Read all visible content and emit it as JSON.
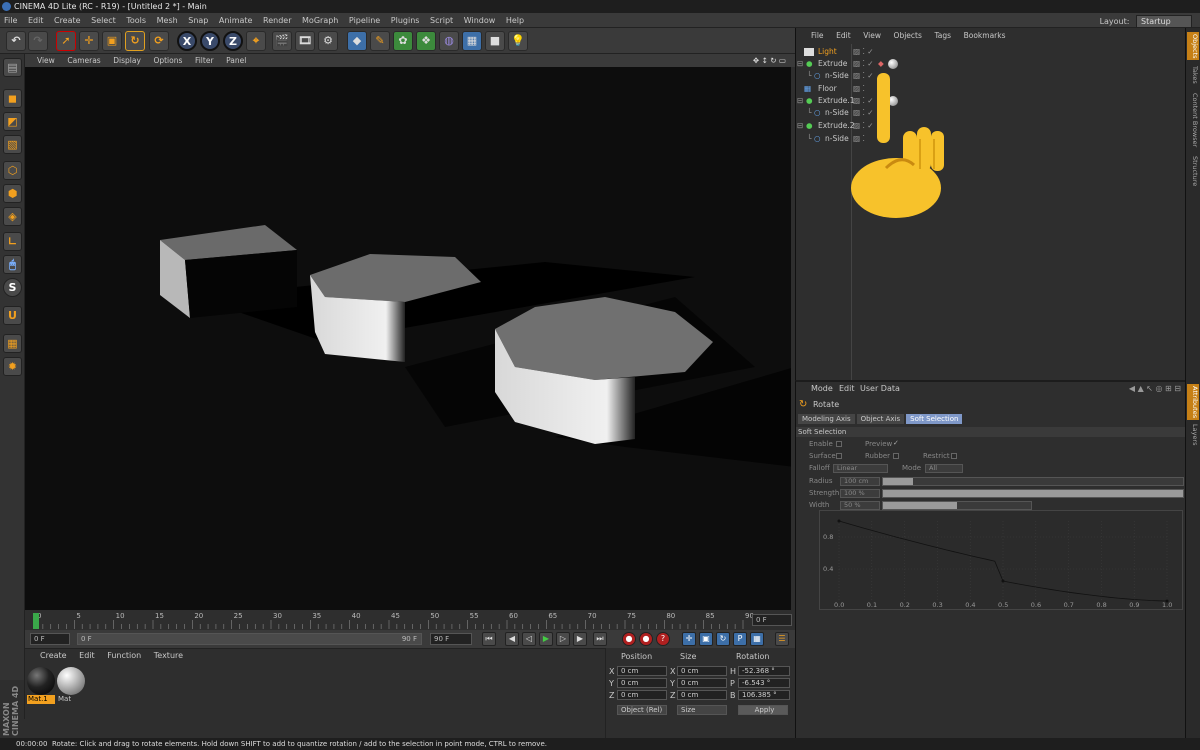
{
  "title_bar": {
    "text": "CINEMA 4D Lite (RC - R19) - [Untitled 2 *] - Main"
  },
  "menu": [
    "File",
    "Edit",
    "Create",
    "Select",
    "Tools",
    "Mesh",
    "Snap",
    "Animate",
    "Render",
    "MoGraph",
    "Pipeline",
    "Plugins",
    "Script",
    "Window",
    "Help"
  ],
  "layout": {
    "label": "Layout:",
    "value": "Startup"
  },
  "viewport": {
    "menu": [
      "View",
      "Cameras",
      "Display",
      "Options",
      "Filter",
      "Panel"
    ]
  },
  "timeline": {
    "ticks": [
      "0",
      "5",
      "10",
      "15",
      "20",
      "25",
      "30",
      "35",
      "40",
      "45",
      "50",
      "55",
      "60",
      "65",
      "70",
      "75",
      "80",
      "85",
      "90"
    ],
    "end_frame": "0 F",
    "current": 0
  },
  "playback": {
    "start_field": "0 F",
    "range_left": "0 F",
    "range_right": "90 F",
    "end_field": "90 F"
  },
  "material_panel": {
    "menu": [
      "Create",
      "Edit",
      "Function",
      "Texture"
    ],
    "materials": [
      {
        "name": "Mat.1",
        "selected": true
      },
      {
        "name": "Mat",
        "selected": false
      }
    ]
  },
  "coordinates": {
    "headers": [
      "Position",
      "Size",
      "Rotation"
    ],
    "rows": [
      {
        "axis": "X",
        "pos": "0 cm",
        "size_axis": "X",
        "size": "0 cm",
        "rot_axis": "H",
        "rot": "-52.368 °"
      },
      {
        "axis": "Y",
        "pos": "0 cm",
        "size_axis": "Y",
        "size": "0 cm",
        "rot_axis": "P",
        "rot": "-6.543 °"
      },
      {
        "axis": "Z",
        "pos": "0 cm",
        "size_axis": "Z",
        "size": "0 cm",
        "rot_axis": "B",
        "rot": "106.385 °"
      }
    ],
    "mode_dropdown": "Object (Rel)",
    "size_dropdown": "Size",
    "apply_label": "Apply"
  },
  "object_manager": {
    "menu": [
      "File",
      "Edit",
      "View",
      "Objects",
      "Tags",
      "Bookmarks"
    ],
    "objects": [
      {
        "name": "Light",
        "level": 0,
        "highlight": true
      },
      {
        "name": "Extrude",
        "level": 0,
        "highlight": false
      },
      {
        "name": "n-Side",
        "level": 1,
        "highlight": false
      },
      {
        "name": "Floor",
        "level": 0,
        "highlight": false
      },
      {
        "name": "Extrude.1",
        "level": 0,
        "highlight": false
      },
      {
        "name": "n-Side",
        "level": 1,
        "highlight": false
      },
      {
        "name": "Extrude.2",
        "level": 0,
        "highlight": false
      },
      {
        "name": "n-Side",
        "level": 1,
        "highlight": false
      }
    ]
  },
  "attributes": {
    "menu": [
      "Mode",
      "Edit",
      "User Data"
    ],
    "tool_name": "Rotate",
    "tabs": [
      "Modeling Axis",
      "Object Axis",
      "Soft Selection"
    ],
    "active_tab": "Soft Selection",
    "section": "Soft Selection",
    "enable_label": "Enable",
    "preview_label": "Preview",
    "preview_check": "✓",
    "surface_label": "Surface",
    "rubber_label": "Rubber",
    "restrict_label": "Restrict",
    "falloff_label": "Falloff",
    "falloff_value": "Linear",
    "mode_label": "Mode",
    "mode_value": "All",
    "radius_label": "Radius",
    "radius_value": "100 cm",
    "radius_fill": 0.1,
    "strength_label": "Strength",
    "strength_value": "100 %",
    "strength_fill": 1.0,
    "width_label": "Width",
    "width_value": "50 %",
    "width_fill": 0.5,
    "graph_y_ticks": [
      "0.8",
      "0.4"
    ],
    "graph_x_ticks": [
      "0.0",
      "0.1",
      "0.2",
      "0.3",
      "0.4",
      "0.5",
      "0.6",
      "0.7",
      "0.8",
      "0.9",
      "1.0"
    ]
  },
  "side_tabs": [
    "Objects",
    "Takes",
    "Content Browser",
    "Structure"
  ],
  "side_tabs_lower": [
    "Attributes",
    "Layers"
  ],
  "status": {
    "time": "00:00:00",
    "message": "Rotate: Click and drag to rotate elements. Hold down SHIFT to add to quantize rotation / add to the selection in point mode, CTRL to remove."
  },
  "brand": "MAXON CINEMA 4D"
}
